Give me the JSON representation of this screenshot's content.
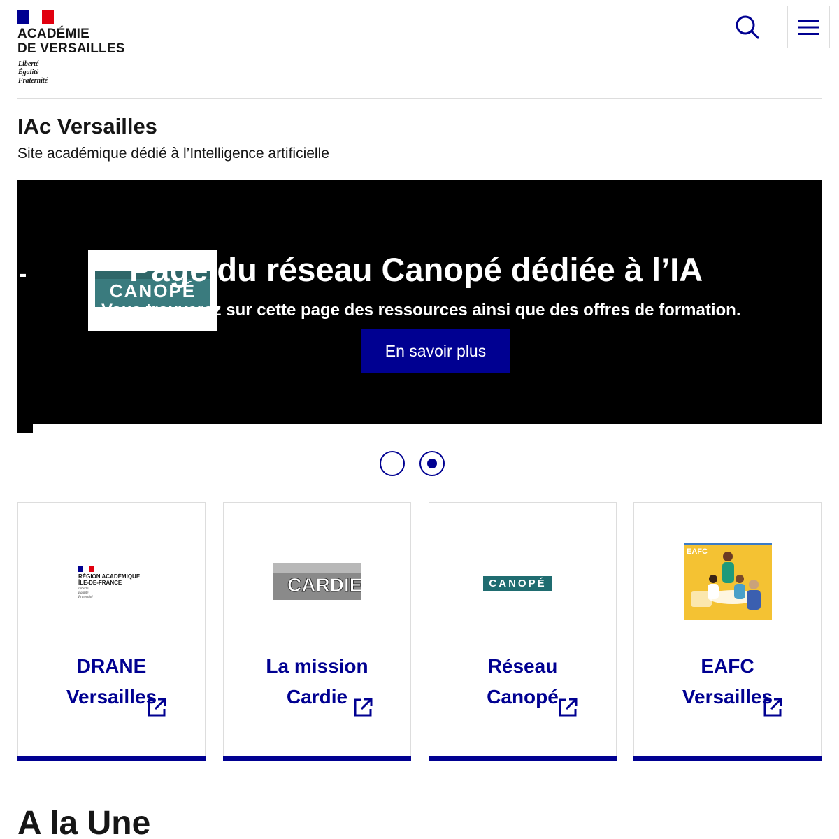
{
  "header": {
    "brand_line1": "ACADÉMIE",
    "brand_line2": "DE VERSAILLES",
    "motto_line1": "Liberté",
    "motto_line2": "Égalité",
    "motto_line3": "Fraternité",
    "search_icon": "search-icon",
    "menu_icon": "hamburger-menu-icon"
  },
  "site": {
    "title": "IAc Versailles",
    "subtitle": "Site académique dédié à l’Intelligence artificielle"
  },
  "carousel": {
    "slide_title": "Page du réseau Canopé dédiée à l’IA",
    "slide_description": "Vous trouverez sur cette page des ressources ainsi que des offres de formation.",
    "slide_button": "En savoir plus",
    "slide_logo_text": "CANOPÉ",
    "dash": "-",
    "active_dot": 2,
    "dot_count": 2
  },
  "cards": [
    {
      "title_line1": "DRANE",
      "title_line2": "Versailles",
      "logo": {
        "line1": "RÉGION ACADÉMIQUE",
        "line2": "ÎLE-DE-FRANCE",
        "motto1": "Liberté",
        "motto2": "Égalité",
        "motto3": "Fraternité"
      },
      "icon": "external-link-icon"
    },
    {
      "title_line1": "La mission",
      "title_line2": "Cardie",
      "logo": {
        "text": "CARDIE"
      },
      "icon": "external-link-icon"
    },
    {
      "title_line1": "Réseau",
      "title_line2": "Canopé",
      "logo": {
        "text": "CANOPÉ"
      },
      "icon": "external-link-icon"
    },
    {
      "title_line1": "EAFC",
      "title_line2": "Versailles",
      "logo": {
        "text": "EAFC"
      },
      "icon": "external-link-icon"
    }
  ],
  "section": {
    "heading": "A la Une"
  },
  "colors": {
    "primary_blue": "#000091",
    "flag_red": "#e1000f",
    "canope_teal": "#1f6c70",
    "eafc_yellow": "#f4c233"
  }
}
